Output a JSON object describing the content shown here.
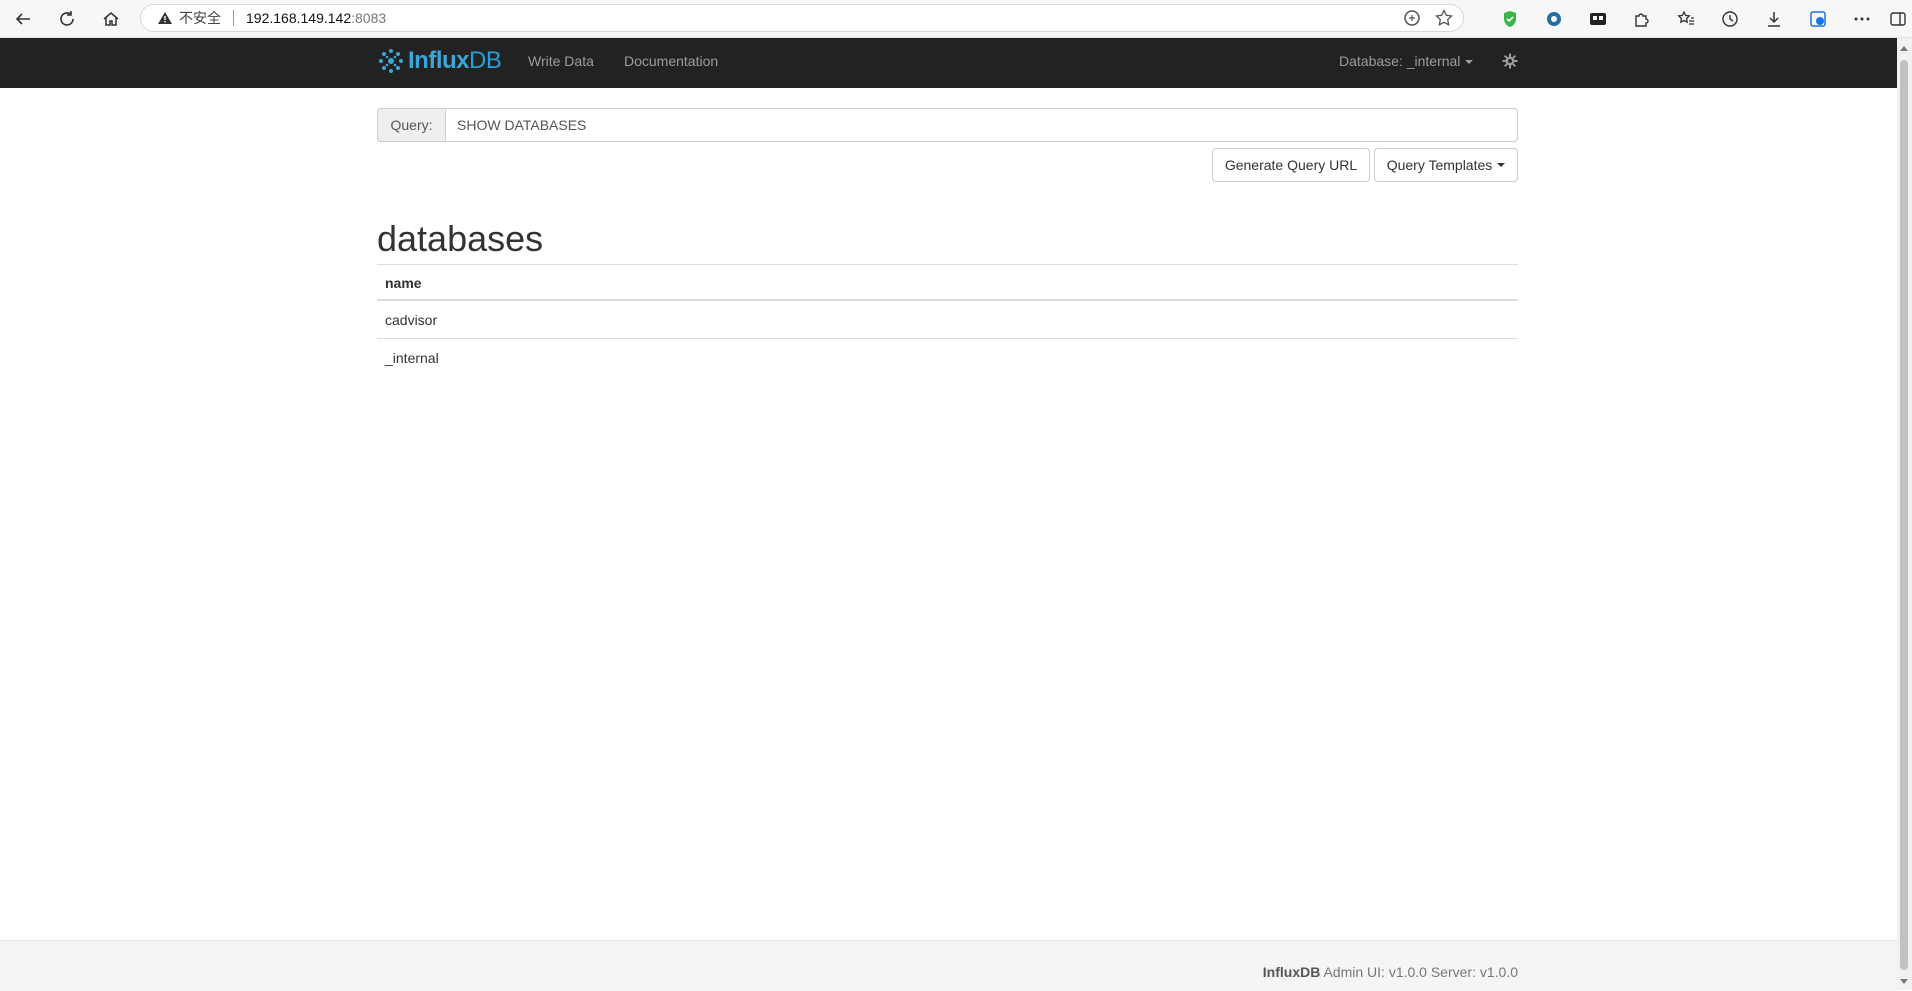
{
  "browser": {
    "insecure_label": "不安全",
    "host": "192.168.149.142",
    "port": ":8083"
  },
  "navbar": {
    "brand_influx": "Influx",
    "brand_db": "DB",
    "write_data": "Write Data",
    "documentation": "Documentation",
    "database_label": "Database: _internal"
  },
  "query": {
    "addon_label": "Query:",
    "value": "SHOW DATABASES",
    "generate_url_button": "Generate Query URL",
    "templates_button": "Query Templates"
  },
  "result": {
    "title": "databases",
    "columns": [
      "name"
    ],
    "rows": [
      [
        "cadvisor"
      ],
      [
        "_internal"
      ]
    ]
  },
  "footer": {
    "brand": "InfluxDB",
    "text": " Admin UI: v1.0.0 Server: v1.0.0"
  },
  "colors": {
    "navbar_bg": "#222222",
    "brand_blue": "#22a0d8"
  }
}
